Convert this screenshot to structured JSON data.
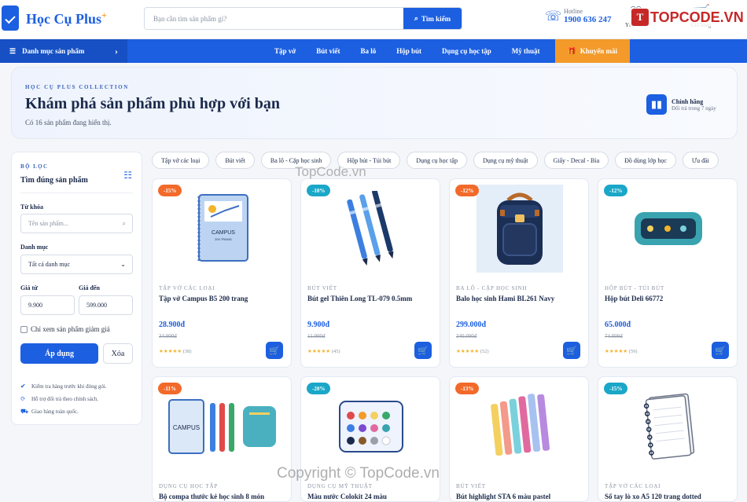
{
  "header": {
    "logo_text": "Học Cụ Plus",
    "logo_sup": "+",
    "search_placeholder": "Bạn cần tìm sản phẩm gì?",
    "search_button": "Tìm kiếm",
    "hotline_label": "Hotline",
    "hotline_number": "1900 636 247",
    "icons": [
      {
        "label": "Yêu thích",
        "icon": "heart-icon"
      },
      {
        "label": "Giỏ hàng",
        "icon": "cart-icon"
      }
    ],
    "watermark": "TOPCODE.VN"
  },
  "nav": {
    "categories_label": "Danh mục sản phẩm",
    "items": [
      "Tập vở",
      "Bút viết",
      "Ba lô",
      "Hộp bút",
      "Dụng cụ học tập",
      "Mỹ thuật"
    ],
    "promo": "Khuyến mãi"
  },
  "hero": {
    "kicker": "HỌC CỤ PLUS COLLECTION",
    "title": "Khám phá sản phẩm phù hợp với bạn",
    "subtitle": "Có 16 sản phẩm đang hiển thị.",
    "badge_title": "Chính hãng",
    "badge_sub": "Đổi trả trong 7 ngày"
  },
  "filter": {
    "kicker": "BỘ LỌC",
    "title": "Tìm đúng sản phẩm",
    "keyword_label": "Từ khóa",
    "keyword_placeholder": "Tên sản phẩm...",
    "category_label": "Danh mục",
    "category_value": "Tất cả danh mục",
    "price_from_label": "Giá từ",
    "price_from": "9.900",
    "price_to_label": "Giá đến",
    "price_to": "599.000",
    "discount_only": "Chỉ xem sản phẩm giảm giá",
    "apply": "Áp dụng",
    "clear": "Xóa",
    "notes": [
      "Kiểm tra hàng trước khi đóng gói.",
      "Hỗ trợ đổi trả theo chính sách.",
      "Giao hàng toàn quốc."
    ]
  },
  "chips": [
    "Tập vở các loại",
    "Bút viết",
    "Ba lô - Cặp học sinh",
    "Hộp bút - Túi bút",
    "Dụng cụ học tập",
    "Dụng cụ mỹ thuật",
    "Giấy - Decal - Bìa",
    "Đồ dùng lớp học",
    "Ưu đãi"
  ],
  "products": [
    {
      "discount": "-15%",
      "badge_color": "#f26a2a",
      "category": "TẬP VỞ CÁC LOẠI",
      "name": "Tập vở Campus B5 200 trang",
      "price": "28.900đ",
      "old_price": "34.000đ",
      "rating": "★★★★★",
      "reviews": "(38)",
      "image": "notebook-image"
    },
    {
      "discount": "-10%",
      "badge_color": "#1aa7c8",
      "category": "BÚT VIẾT",
      "name": "Bút gel Thiên Long TL-079 0.5mm",
      "price": "9.900đ",
      "old_price": "11.000đ",
      "rating": "★★★★★",
      "reviews": "(45)",
      "image": "pens-image"
    },
    {
      "discount": "-12%",
      "badge_color": "#f26a2a",
      "category": "BA LÔ - CẶP HỌC SINH",
      "name": "Balo học sinh Hami BL261 Navy",
      "price": "299.000đ",
      "old_price": "340.000đ",
      "rating": "★★★★★",
      "reviews": "(52)",
      "image": "backpack-image"
    },
    {
      "discount": "-12%",
      "badge_color": "#1aa7c8",
      "category": "HỘP BÚT - TÚI BÚT",
      "name": "Hộp bút Deli 66772",
      "price": "65.000đ",
      "old_price": "74.000đ",
      "rating": "★★★★★",
      "reviews": "(59)",
      "image": "pencil-case-image"
    },
    {
      "discount": "-11%",
      "badge_color": "#f26a2a",
      "category": "DỤNG CỤ HỌC TẬP",
      "name": "Bộ compa thước kẻ học sinh 8 món",
      "price": "",
      "old_price": "",
      "rating": "",
      "reviews": "",
      "image": "school-kit-image"
    },
    {
      "discount": "-20%",
      "badge_color": "#1aa7c8",
      "category": "DỤNG CỤ MỸ THUẬT",
      "name": "Màu nước Colokit 24 màu",
      "price": "",
      "old_price": "",
      "rating": "",
      "reviews": "",
      "image": "watercolor-image"
    },
    {
      "discount": "-13%",
      "badge_color": "#f26a2a",
      "category": "BÚT VIẾT",
      "name": "Bút highlight STA 6 màu pastel",
      "price": "",
      "old_price": "",
      "rating": "",
      "reviews": "",
      "image": "highlighters-image"
    },
    {
      "discount": "-15%",
      "badge_color": "#1aa7c8",
      "category": "TẬP VỞ CÁC LOẠI",
      "name": "Sổ tay lò xo A5 120 trang dotted",
      "price": "",
      "old_price": "",
      "rating": "",
      "reviews": "",
      "image": "spiral-notebook-image"
    }
  ],
  "watermarks": {
    "middle": "TopCode.vn",
    "bottom": "Copyright © TopCode.vn"
  }
}
